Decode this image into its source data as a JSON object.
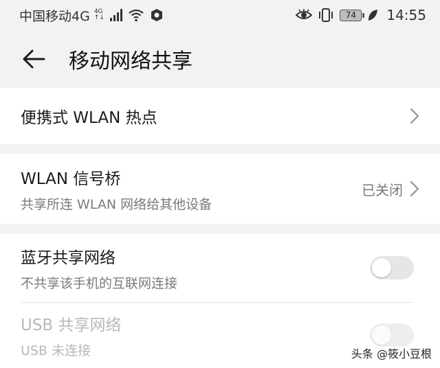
{
  "status_bar": {
    "carrier": "中国移动4G",
    "net_top": "4G",
    "net_bottom": "↑↓",
    "battery": "74",
    "time": "14:55"
  },
  "header": {
    "title": "移动网络共享"
  },
  "items": {
    "hotspot": {
      "title": "便携式 WLAN 热点"
    },
    "bridge": {
      "title": "WLAN 信号桥",
      "subtitle": "共享所连 WLAN 网络给其他设备",
      "status": "已关闭"
    },
    "bluetooth": {
      "title": "蓝牙共享网络",
      "subtitle": "不共享该手机的互联网连接",
      "enabled": false
    },
    "usb": {
      "title": "USB 共享网络",
      "subtitle": "USB 未连接",
      "enabled": false,
      "disabled": true
    }
  },
  "watermark": "头条 @筱小豆根",
  "colors": {
    "background": "#f2f2f2",
    "card": "#ffffff",
    "secondary_text": "#7a7a7a",
    "disabled_text": "#b8b8b8"
  }
}
